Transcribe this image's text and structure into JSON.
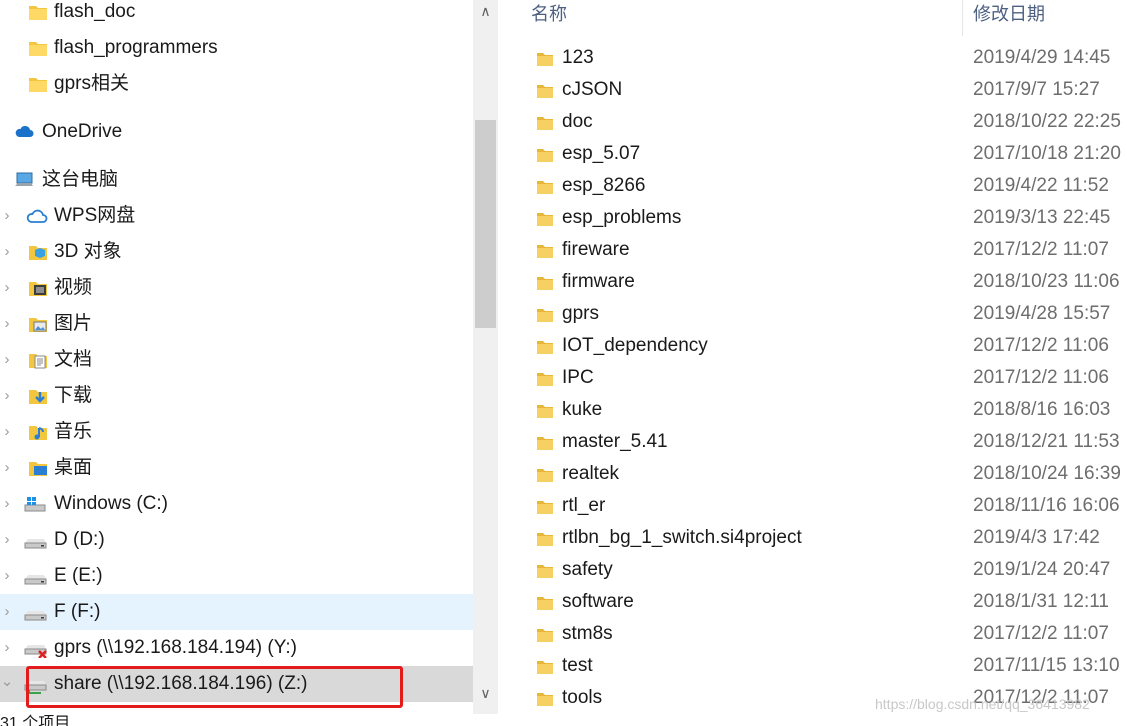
{
  "nav": {
    "items": [
      {
        "label": "flash_doc",
        "icon": "folder-icon"
      },
      {
        "label": "flash_programmers",
        "icon": "folder-icon"
      },
      {
        "label": "gprs相关",
        "icon": "folder-icon"
      },
      {
        "label": "OneDrive",
        "icon": "onedrive-cloud-icon"
      },
      {
        "label": "这台电脑",
        "icon": "this-pc-icon"
      },
      {
        "label": "WPS网盘",
        "icon": "wps-cloud-icon"
      },
      {
        "label": "3D 对象",
        "icon": "3d-objects-folder-icon"
      },
      {
        "label": "视频",
        "icon": "videos-folder-icon"
      },
      {
        "label": "图片",
        "icon": "pictures-folder-icon"
      },
      {
        "label": "文档",
        "icon": "documents-folder-icon"
      },
      {
        "label": "下载",
        "icon": "downloads-folder-icon"
      },
      {
        "label": "音乐",
        "icon": "music-folder-icon"
      },
      {
        "label": "桌面",
        "icon": "desktop-folder-icon"
      },
      {
        "label": "Windows (C:)",
        "icon": "windows-drive-icon"
      },
      {
        "label": "D (D:)",
        "icon": "drive-icon"
      },
      {
        "label": "E (E:)",
        "icon": "drive-icon"
      },
      {
        "label": "F (F:)",
        "icon": "drive-icon"
      },
      {
        "label": "gprs (\\\\192.168.184.194) (Y:)",
        "icon": "network-drive-disconnected-icon"
      },
      {
        "label": "share (\\\\192.168.184.196) (Z:)",
        "icon": "network-drive-icon"
      }
    ]
  },
  "status": {
    "item_count": "31 个项目"
  },
  "columns": {
    "name": "名称",
    "date": "修改日期"
  },
  "files": [
    {
      "name": "123",
      "date": "2019/4/29 14:45"
    },
    {
      "name": "cJSON",
      "date": "2017/9/7 15:27"
    },
    {
      "name": "doc",
      "date": "2018/10/22 22:25"
    },
    {
      "name": "esp_5.07",
      "date": "2017/10/18 21:20"
    },
    {
      "name": "esp_8266",
      "date": "2019/4/22 11:52"
    },
    {
      "name": "esp_problems",
      "date": "2019/3/13 22:45"
    },
    {
      "name": "fireware",
      "date": "2017/12/2 11:07"
    },
    {
      "name": "firmware",
      "date": "2018/10/23 11:06"
    },
    {
      "name": "gprs",
      "date": "2019/4/28 15:57"
    },
    {
      "name": "IOT_dependency",
      "date": "2017/12/2 11:06"
    },
    {
      "name": "IPC",
      "date": "2017/12/2 11:06"
    },
    {
      "name": "kuke",
      "date": "2018/8/16 16:03"
    },
    {
      "name": "master_5.41",
      "date": "2018/12/21 11:53"
    },
    {
      "name": "realtek",
      "date": "2018/10/24 16:39"
    },
    {
      "name": "rtl_er",
      "date": "2018/11/16 16:06"
    },
    {
      "name": "rtlbn_bg_1_switch.si4project",
      "date": "2019/4/3 17:42"
    },
    {
      "name": "safety",
      "date": "2019/1/24 20:47"
    },
    {
      "name": "software",
      "date": "2018/1/31 12:11"
    },
    {
      "name": "stm8s",
      "date": "2017/12/2 11:07"
    },
    {
      "name": "test",
      "date": "2017/11/15 13:10"
    },
    {
      "name": "tools",
      "date": "2017/12/2 11:07"
    }
  ],
  "watermark": "https://blog.csdn.net/qq_36413982",
  "colors": {
    "hover": "#e5f3ff",
    "selected": "#d9d9d9",
    "highlight_box": "#e31b1b",
    "folder": "#f3c640"
  }
}
